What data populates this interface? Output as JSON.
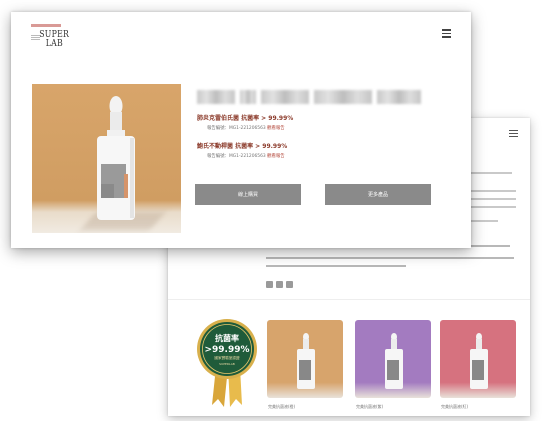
{
  "front": {
    "logo": {
      "word_line1": "SUPER",
      "word_line2": "LAB"
    },
    "claims": [
      {
        "title": "肺炎克雷伯氏菌 抗菌率 > 99.99%",
        "reg_prefix": "報告編號：MG1-221206563",
        "reg_link": "觀看報告"
      },
      {
        "title": "鮑氏不動桿菌 抗菌率 > 99.99%",
        "reg_prefix": "報告編號：MG1-221206563",
        "reg_link": "觀看報告"
      }
    ],
    "buttons": {
      "primary": "線上購買",
      "secondary": "更多產品"
    }
  },
  "back": {
    "badge": {
      "top": "抗菌率",
      "value": ">99.99%",
      "sub": "國家實驗室認證",
      "brand": "SUPERLAB"
    },
    "thumbnails": [
      {
        "caption": "完美抗菌液(橙)",
        "color": "#d7a46c"
      },
      {
        "caption": "完美抗菌液(紫)",
        "color": "#a37bc0"
      },
      {
        "caption": "完美抗菌液(紅)",
        "color": "#d6727f"
      }
    ]
  },
  "colors": {
    "accent_text": "#8b3a2a",
    "button": "#8a8a8a",
    "logo_bar": "#d99a96"
  }
}
